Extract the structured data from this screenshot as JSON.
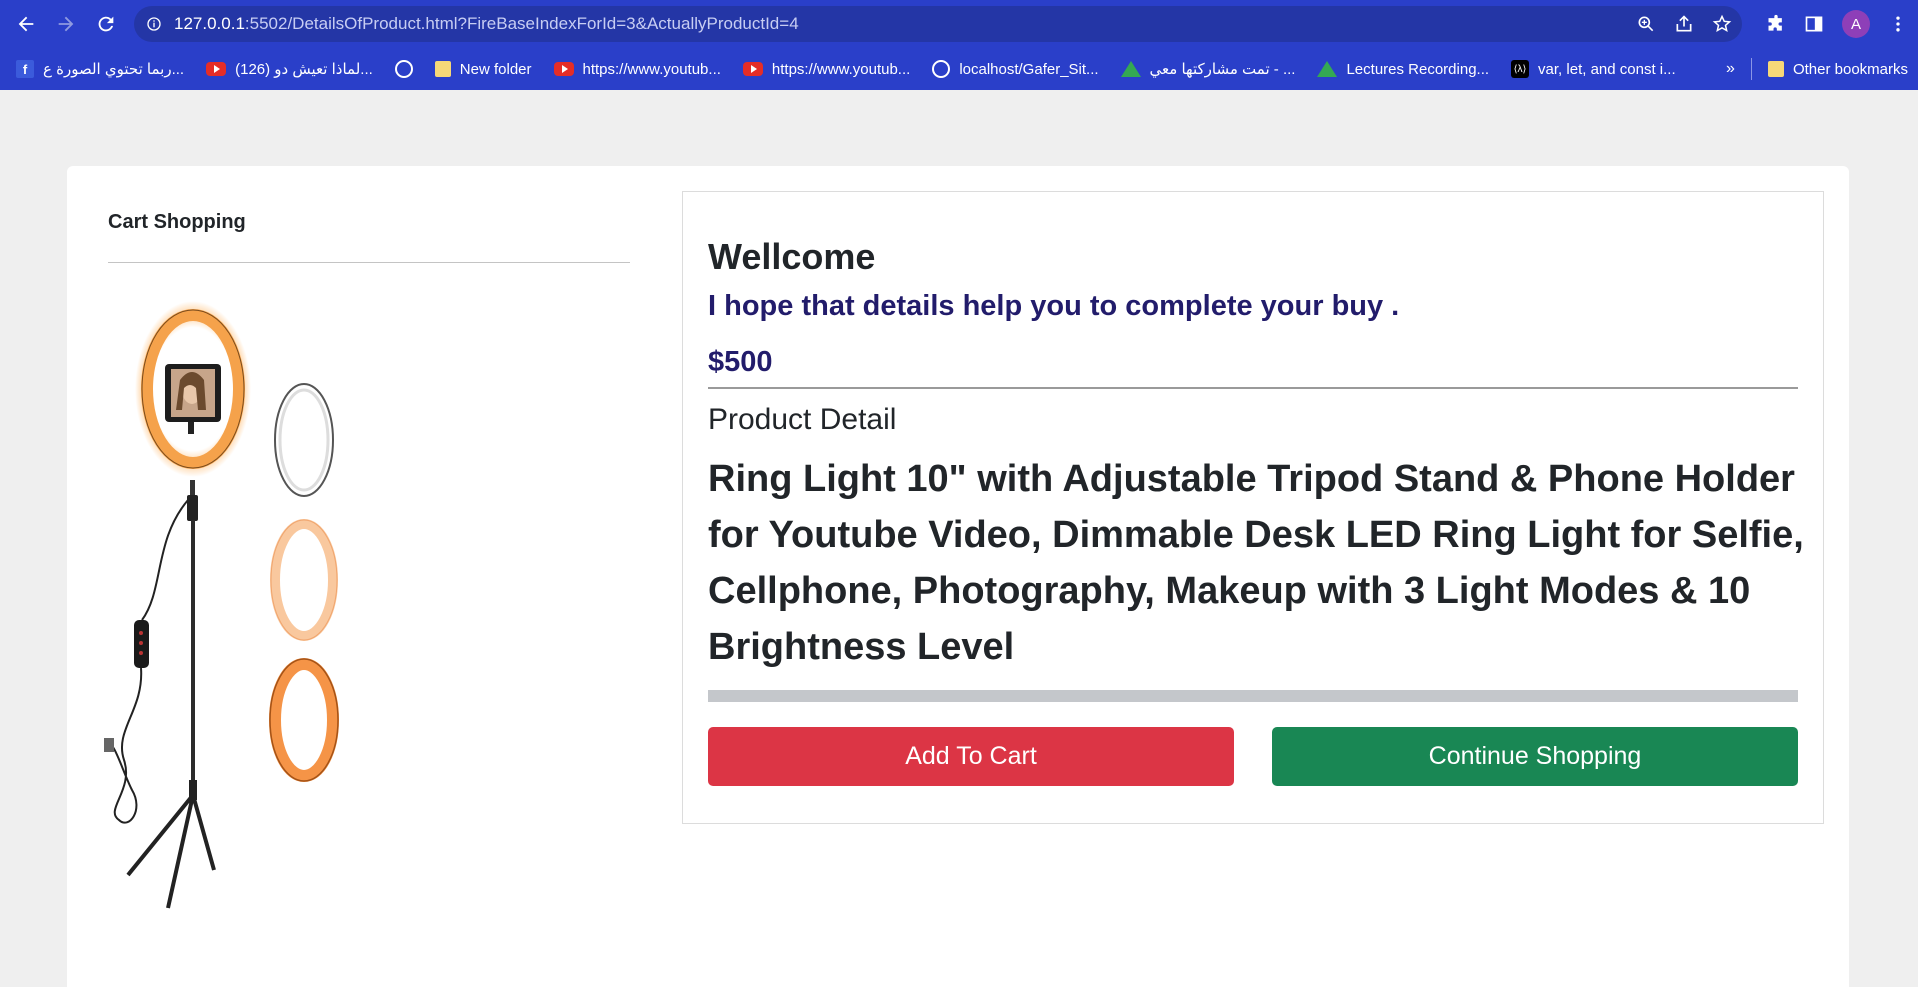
{
  "browser": {
    "url_host": "127.0.0.1",
    "url_rest": ":5502/DetailsOfProduct.html?FireBaseIndexForId=3&ActuallyProductId=4",
    "avatar_letter": "A",
    "bookmarks": [
      {
        "label": "ربما تحتوي الصورة ع...",
        "icon": "facebook-icon"
      },
      {
        "label": "(126) لماذا تعيش دو...",
        "icon": "youtube-icon"
      },
      {
        "label": "",
        "icon": "globe-icon"
      },
      {
        "label": "New folder",
        "icon": "folder-icon"
      },
      {
        "label": "https://www.youtub...",
        "icon": "youtube-icon"
      },
      {
        "label": "https://www.youtub...",
        "icon": "youtube-icon"
      },
      {
        "label": "localhost/Gafer_Sit...",
        "icon": "globe-icon"
      },
      {
        "label": "تمت مشاركتها معي - ...",
        "icon": "google-drive-icon"
      },
      {
        "label": "Lectures Recording...",
        "icon": "google-drive-icon"
      },
      {
        "label": "var, let, and const i...",
        "icon": "dev-icon"
      }
    ],
    "overflow": "»",
    "other_bookmarks": "Other bookmarks"
  },
  "sidebar": {
    "title": "Cart Shopping"
  },
  "product": {
    "welcome": "Wellcome",
    "subtitle": "I hope that details help you to complete your buy .",
    "price": "$500",
    "detail_label": "Product Detail",
    "name": "Ring Light 10\" with Adjustable Tripod Stand & Phone Holder for Youtube Video, Dimmable Desk LED Ring Light for Selfie, Cellphone, Photography, Makeup with 3 Light Modes & 10 Brightness Level",
    "add_to_cart": "Add To Cart",
    "continue_shopping": "Continue Shopping"
  },
  "colors": {
    "browser_bar": "#2a3fc9",
    "price_text": "#221c6b",
    "add_button": "#dc3545",
    "continue_button": "#198754"
  }
}
